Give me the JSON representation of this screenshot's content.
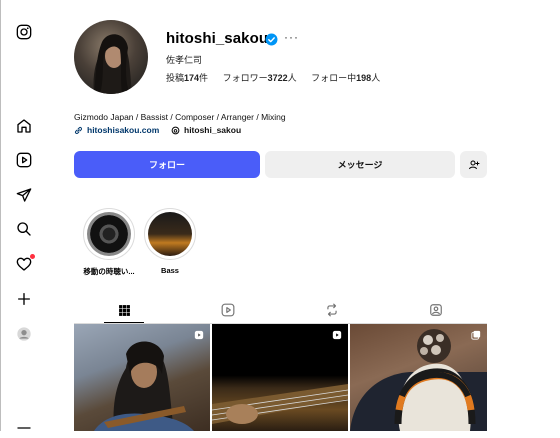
{
  "profile": {
    "username": "hitoshi_sakou",
    "real_name": "佐孝仁司",
    "more": "···",
    "stats": {
      "posts_label": "投稿",
      "posts_value": "174",
      "posts_unit": "件",
      "followers_label": "フォロワー",
      "followers_value": "3722",
      "followers_unit": "人",
      "following_label": "フォロー中",
      "following_value": "198",
      "following_unit": "人"
    },
    "bio": "Gizmodo Japan / Bassist / Composer / Arranger / Mixing",
    "link": "hitoshisakou.com",
    "threads": "hitoshi_sakou"
  },
  "buttons": {
    "follow": "フォロー",
    "message": "メッセージ"
  },
  "highlights": [
    {
      "label": "移動の時聴い..."
    },
    {
      "label": "Bass"
    }
  ],
  "sidebar": {
    "icons": [
      "instagram-icon",
      "home-icon",
      "reels-icon",
      "messages-icon",
      "search-icon",
      "notifications-icon",
      "create-icon",
      "profile-icon",
      "menu-icon"
    ]
  },
  "colors": {
    "accent": "#4a5df9",
    "verified": "#0095f6",
    "notif": "#ff3040"
  }
}
